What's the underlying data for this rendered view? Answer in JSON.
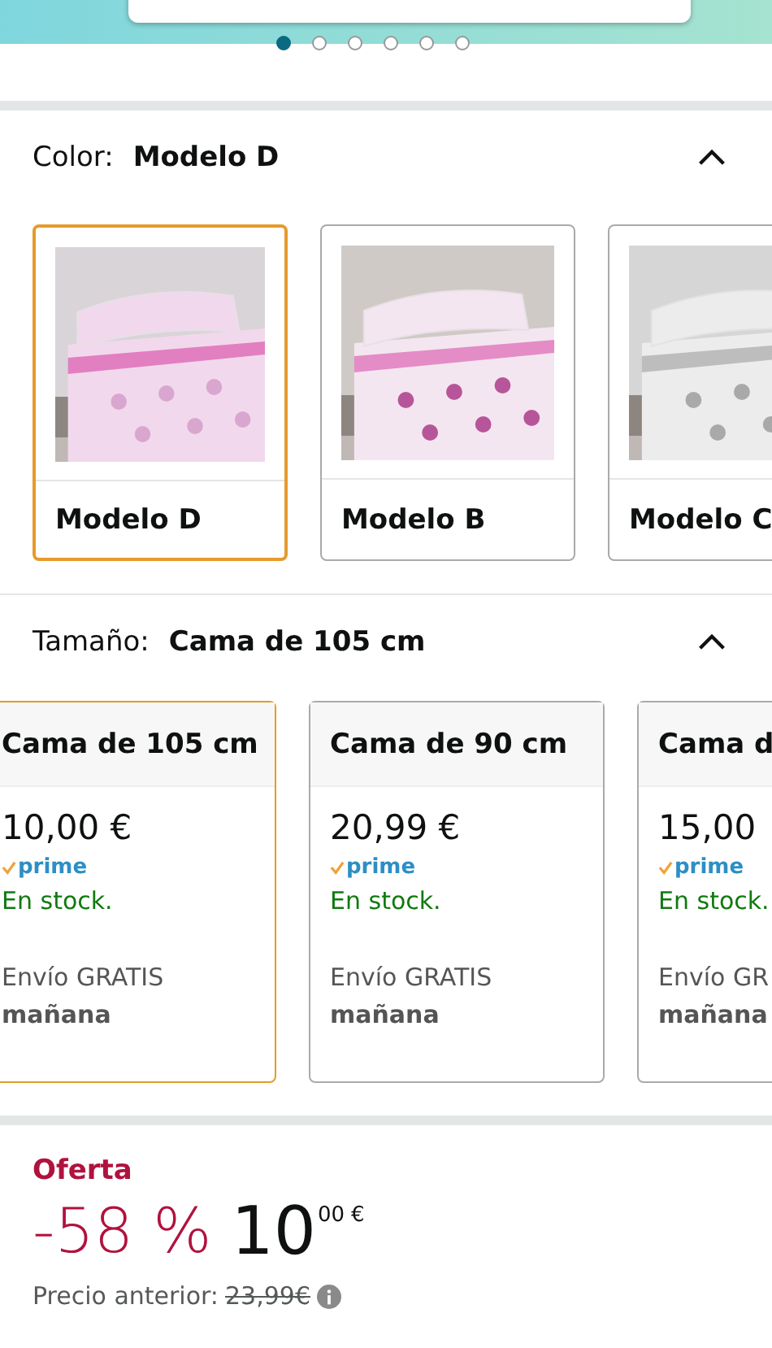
{
  "carousel": {
    "dots": [
      {
        "selected": true
      },
      {
        "selected": false
      },
      {
        "selected": false
      },
      {
        "selected": false
      },
      {
        "selected": false
      },
      {
        "selected": false
      }
    ]
  },
  "color": {
    "label": "Color:",
    "value": "Modelo D",
    "expanded": true,
    "options": [
      {
        "name": "Modelo D",
        "selected": true,
        "kind": "picture"
      },
      {
        "name": "Modelo B",
        "selected": false,
        "kind": "picture"
      },
      {
        "name": "Modelo C",
        "selected": false,
        "kind": "picture"
      }
    ]
  },
  "size": {
    "label": "Tamaño:",
    "value": "Cama de 105 cm",
    "expanded": true,
    "options": [
      {
        "name": "Cama de 105 cm",
        "price": "10,00 €",
        "prime": "prime",
        "stock": "En stock.",
        "shipping": "Envío GRATIS",
        "delivery": "mañana",
        "selected": true
      },
      {
        "name": "Cama de 90 cm",
        "price": "20,99 €",
        "prime": "prime",
        "stock": "En stock.",
        "shipping": "Envío GRATIS",
        "delivery": "mañana",
        "selected": false
      },
      {
        "name": "Cama d",
        "price": "15,00",
        "prime": "prime",
        "stock": "En stock.",
        "shipping": "Envío GR",
        "delivery": "mañana",
        "selected": false
      }
    ]
  },
  "offer": {
    "label": "Oferta",
    "discount": "-58 %",
    "price_whole": "10",
    "price_fraction": "00",
    "currency": "€",
    "previous_label": "Precio anterior:",
    "previous_price": "23,99€"
  }
}
